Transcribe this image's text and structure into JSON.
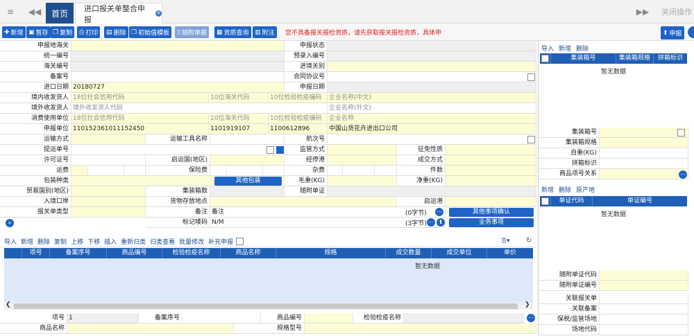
{
  "tabs": {
    "home": "首页",
    "current": "进口报关单整合申报",
    "close_ops": "关闭操作"
  },
  "toolbar": {
    "buttons": [
      "新增",
      "暂存",
      "复制",
      "打印",
      "删除",
      "初始值模板",
      "随附单据",
      "资质查询",
      "附注"
    ],
    "declare": "申报",
    "warning": "您不具备报关报检资质，请先获取报关报检资质，具体申"
  },
  "form": {
    "r1": {
      "l1": "申报地海关",
      "l2": "申报状态"
    },
    "r2": {
      "l1": "统一编号",
      "l2": "预录入编号"
    },
    "r3": {
      "l1": "海关编号",
      "l2": "进境关别"
    },
    "r4": {
      "l1": "备案号",
      "l2": "合同协议号"
    },
    "r5": {
      "l1": "进口日期",
      "v1": "20180727",
      "l2": "申报日期"
    },
    "r6": {
      "l1": "境内收发货人",
      "p1": "18位社会信用代码",
      "p2": "10位海关代码",
      "p3": "10位检验检疫编码",
      "p4": "企业名称(中文)"
    },
    "r7": {
      "l1": "境外收发货人",
      "p1": "境外收发货人代码",
      "p2": "企业名称(外文)"
    },
    "r8": {
      "l1": "消费使用单位",
      "p1": "18位社会信用代码",
      "p2": "10位海关代码",
      "p3": "10位检验检疫编码",
      "p4": "企业名称"
    },
    "r9": {
      "l1": "申报单位",
      "v1": "110152361011152450",
      "v2": "1101919107",
      "v3": "1100612896",
      "v4": "中国山货花卉进出口公司"
    },
    "r10": {
      "l1": "运输方式",
      "l2": "运输工具名称",
      "l3": "航次号"
    },
    "r11": {
      "l1": "提运单号",
      "l2": "监管方式",
      "l3": "征免性质"
    },
    "r12": {
      "l1": "许可证号",
      "l2": "启运国(地区)",
      "l3": "经停港",
      "l4": "成交方式"
    },
    "r13": {
      "l1": "运费",
      "l2": "保险费",
      "l3": "杂费",
      "l4": "件数"
    },
    "r14": {
      "l1": "包装种类",
      "btn": "其他包装",
      "l3": "毛重(KG)",
      "l4": "净重(KG)"
    },
    "r15": {
      "l1": "贸易国别(地区)",
      "l2": "集装箱数",
      "l3": "随附单证"
    },
    "r16": {
      "l1": "入境口岸",
      "l2": "货物存放地点",
      "l3": "启运港"
    },
    "r17": {
      "l1": "报关单类型",
      "l2": "备注",
      "v2": "备注",
      "cnt": "(0字节)",
      "btn": "其他事项确认"
    },
    "r18": {
      "l2": "标记唛码",
      "v2": "N/M",
      "cnt": "(3字节)",
      "btn": "业务事项"
    }
  },
  "goods_toolbar": [
    "导入",
    "新增",
    "删除",
    "复制",
    "上移",
    "下移",
    "插入",
    "重新归类",
    "归类查看",
    "批量修改",
    "补充申报"
  ],
  "goods_table": {
    "headers": [
      "项号",
      "备案序号",
      "商品编号",
      "检验检疫名称",
      "商品名称",
      "规格",
      "成交数量",
      "成交单位",
      "单价"
    ],
    "empty": "暂无数据"
  },
  "goods_form": {
    "l1": "项号",
    "v1": "1",
    "l2": "备案序号",
    "l3": "商品编号",
    "l4": "检验检疫名称",
    "l5": "商品名称",
    "l6": "规格型号"
  },
  "container_panel": {
    "tools": [
      "导入",
      "新增",
      "删除"
    ],
    "headers": [
      "集装箱号",
      "集装箱规格",
      "拼箱标识"
    ],
    "empty": "暂无数据",
    "fields": [
      "集装箱号",
      "集装箱规格",
      "自重(KG)",
      "拼箱标识",
      "商品项号关系"
    ]
  },
  "doc_panel": {
    "tools": [
      "新增",
      "删除",
      "原产地"
    ],
    "headers": [
      "单证代码",
      "单证编号"
    ],
    "empty": "暂无数据",
    "fields": [
      "随附单证代码",
      "随附单证编号"
    ]
  },
  "related": [
    "关联报关单",
    "关联备案",
    "保税/监管场地",
    "场地代码"
  ],
  "colors": {
    "primary": "#1f63c6",
    "header": "#1f5fb5",
    "field_yellow": "#fdfdd5",
    "warning": "#e02020"
  }
}
